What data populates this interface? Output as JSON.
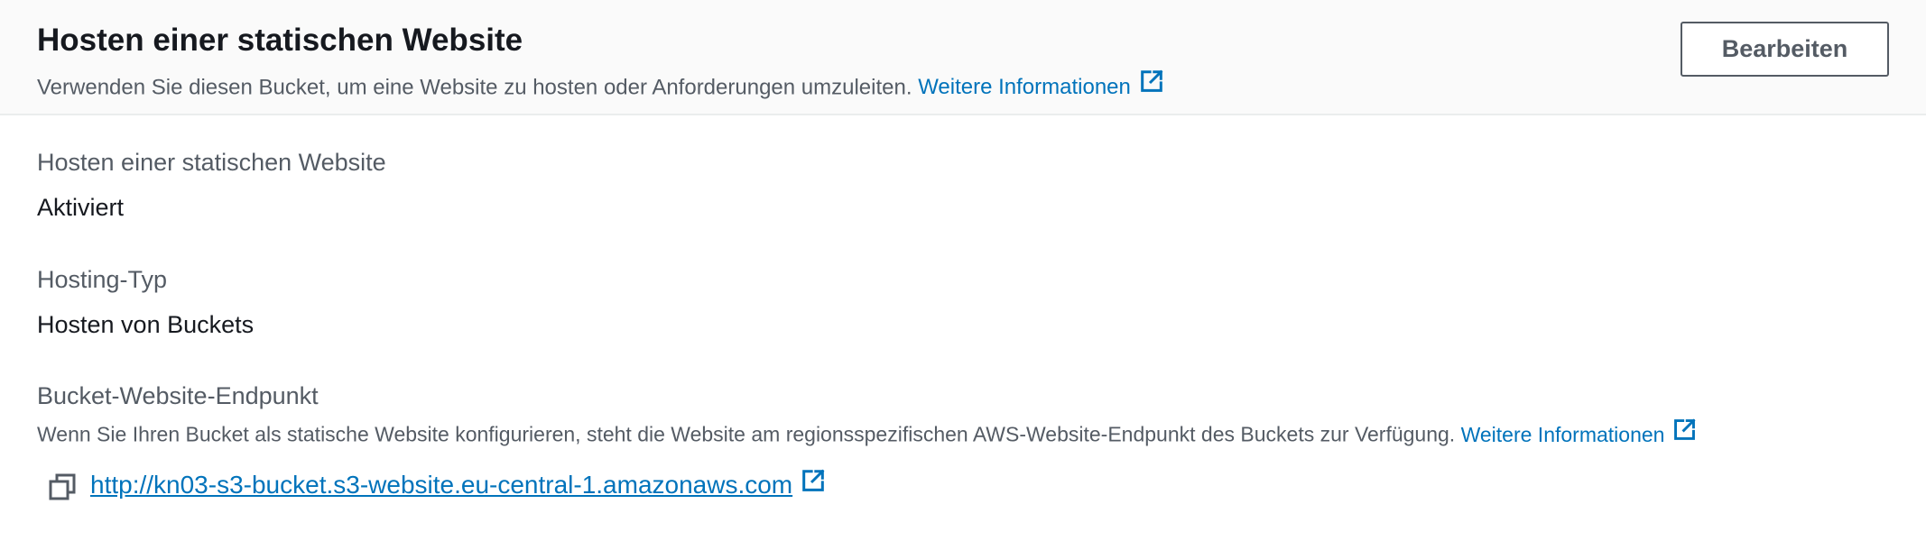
{
  "header": {
    "title": "Hosten einer statischen Website",
    "description": "Verwenden Sie diesen Bucket, um eine Website zu hosten oder Anforderungen umzuleiten.",
    "info_link": "Weitere Informationen",
    "edit_label": "Bearbeiten"
  },
  "fields": {
    "static_hosting": {
      "label": "Hosten einer statischen Website",
      "value": "Aktiviert"
    },
    "hosting_type": {
      "label": "Hosting-Typ",
      "value": "Hosten von Buckets"
    },
    "endpoint": {
      "label": "Bucket-Website-Endpunkt",
      "description": "Wenn Sie Ihren Bucket als statische Website konfigurieren, steht die Website am regionsspezifischen AWS-Website-Endpunkt des Buckets zur Verfügung.",
      "info_link": "Weitere Informationen",
      "url": "http://kn03-s3-bucket.s3-website.eu-central-1.amazonaws.com"
    }
  },
  "icons": {
    "external_link": "external-link-icon",
    "copy": "copy-icon"
  },
  "colors": {
    "link": "#0073bb",
    "text": "#16191f",
    "secondary_text": "#545b64",
    "header_bg": "#fafafa"
  }
}
